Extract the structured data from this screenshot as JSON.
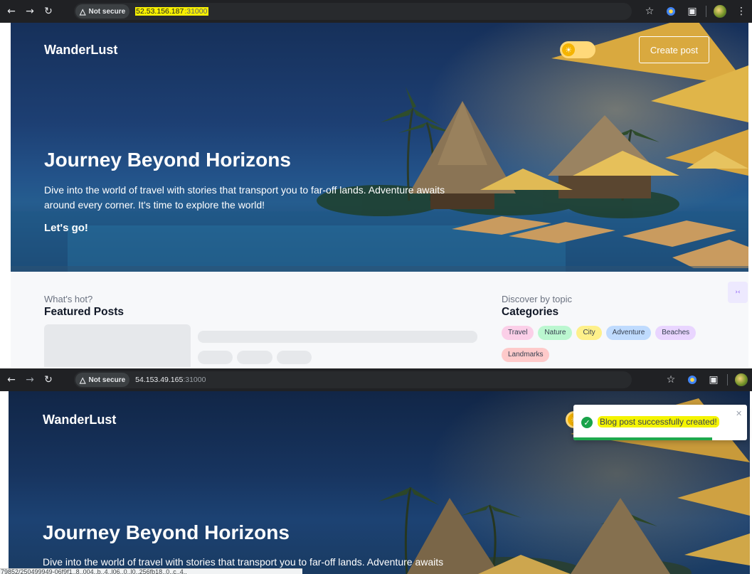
{
  "browser_top": {
    "security_label": "Not secure",
    "host": "52.53.156.187",
    "port": ":31000"
  },
  "browser_bottom": {
    "security_label": "Not secure",
    "host": "54.153.49.165",
    "port": ":31000"
  },
  "site": {
    "brand": "WanderLust",
    "create_post_label": "Create post",
    "hero": {
      "title": "Journey Beyond Horizons",
      "description": "Dive into the world of travel with stories that transport you to far-off lands. Adventure awaits around every corner. It's time to explore the world!",
      "cta": "Let's go!"
    }
  },
  "featured": {
    "eyebrow": "What's hot?",
    "title": "Featured Posts"
  },
  "categories": {
    "eyebrow": "Discover by topic",
    "title": "Categories",
    "items": [
      "Travel",
      "Nature",
      "City",
      "Adventure",
      "Beaches",
      "Landmarks"
    ],
    "colors": [
      "#fbcfe8",
      "#bbf7d0",
      "#fef08a",
      "#bfdbfe",
      "#e9d5ff",
      "#fecaca"
    ]
  },
  "toast": {
    "message": "Blog post successfully created!",
    "progress": 0.8
  },
  "statusbar_text": "79852/250499949-06f9f1..8..004..b..4..l06..0..l0..256fb18..0..c..4..",
  "colors": {
    "chrome_bg": "#202124",
    "url_highlight": "#f8f000",
    "toast_success": "#19a34a",
    "toggle_bg": "#ffd97a"
  }
}
